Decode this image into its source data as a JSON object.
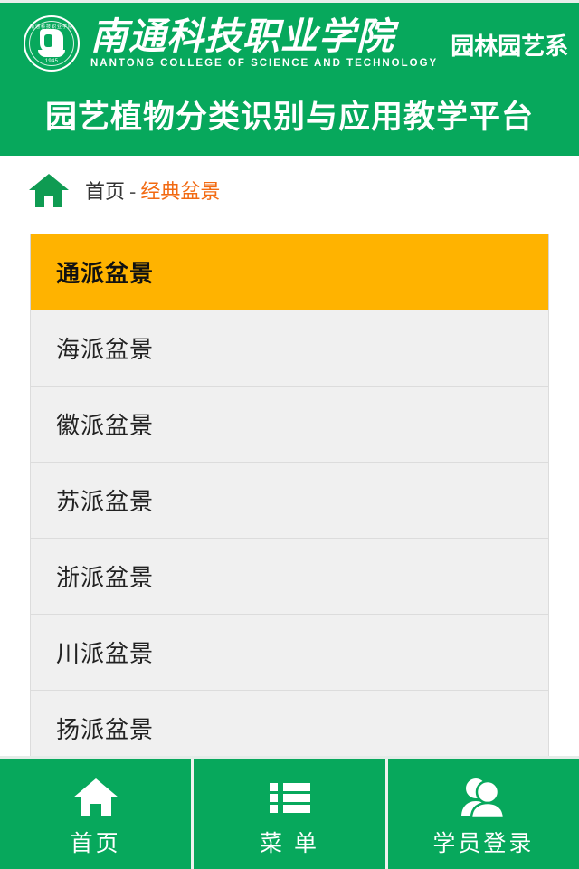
{
  "header": {
    "logo_icon": "college-seal-icon",
    "seal_arc_text": "南通科技职业学院",
    "seal_year": "1945",
    "brand_cn": "南通科技职业学院",
    "brand_en": "NANTONG COLLEGE OF SCIENCE AND TECHNOLOGY",
    "brand_dept": "园林园艺系",
    "title": "园艺植物分类识别与应用教学平台",
    "bg_color": "#07a85c"
  },
  "breadcrumb": {
    "home_icon": "home-icon",
    "home_label": "首页",
    "separator": "-",
    "current": "经典盆景",
    "current_color": "#f26a12"
  },
  "list": {
    "active_color": "#ffb300",
    "item_bg": "#f0f0f0",
    "items": [
      {
        "label": "通派盆景",
        "active": true
      },
      {
        "label": "海派盆景",
        "active": false
      },
      {
        "label": "徽派盆景",
        "active": false
      },
      {
        "label": "苏派盆景",
        "active": false
      },
      {
        "label": "浙派盆景",
        "active": false
      },
      {
        "label": "川派盆景",
        "active": false
      },
      {
        "label": "扬派盆景",
        "active": false
      }
    ]
  },
  "bottomnav": {
    "bg_color": "#07a85c",
    "items": [
      {
        "label": "首页",
        "icon": "home-icon"
      },
      {
        "label": "菜 单",
        "icon": "list-menu-icon"
      },
      {
        "label": "学员登录",
        "icon": "users-icon"
      }
    ]
  }
}
